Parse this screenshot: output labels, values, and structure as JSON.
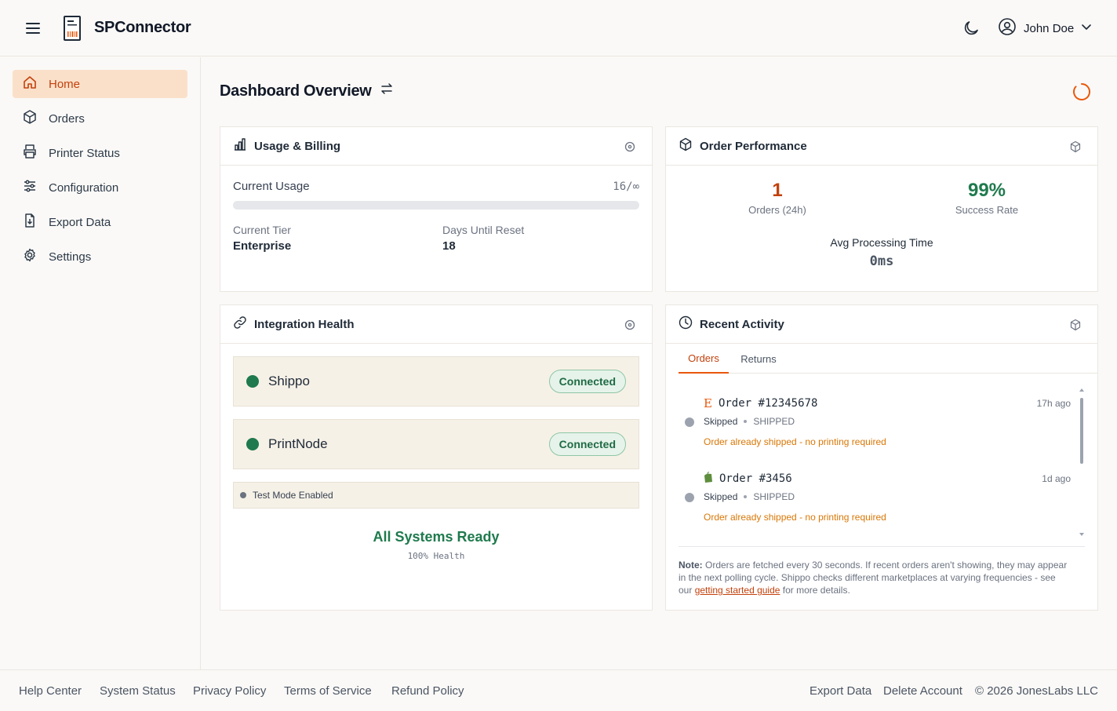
{
  "app": {
    "brand": "SPConnector"
  },
  "user": {
    "name": "John Doe"
  },
  "sidebar": {
    "items": [
      {
        "label": "Home",
        "icon": "home-icon",
        "active": true
      },
      {
        "label": "Orders",
        "icon": "box-icon"
      },
      {
        "label": "Printer Status",
        "icon": "printer-icon"
      },
      {
        "label": "Configuration",
        "icon": "sliders-icon"
      },
      {
        "label": "Export Data",
        "icon": "file-export-icon"
      },
      {
        "label": "Settings",
        "icon": "gear-icon"
      }
    ]
  },
  "page": {
    "title": "Dashboard Overview"
  },
  "usage": {
    "title": "Usage & Billing",
    "current_usage_label": "Current Usage",
    "current_usage_value": "16/∞",
    "progress_fraction": 0,
    "tier_label": "Current Tier",
    "tier_value": "Enterprise",
    "reset_label": "Days Until Reset",
    "reset_value": "18"
  },
  "performance": {
    "title": "Order Performance",
    "orders_value": "1",
    "orders_label": "Orders (24h)",
    "success_value": "99%",
    "success_label": "Success Rate",
    "avg_label": "Avg Processing Time",
    "avg_value": "0ms"
  },
  "integration": {
    "title": "Integration Health",
    "services": [
      {
        "name": "Shippo",
        "status": "Connected"
      },
      {
        "name": "PrintNode",
        "status": "Connected"
      }
    ],
    "test_mode": "Test Mode Enabled",
    "ready_text": "All Systems Ready",
    "health_text": "100% Health"
  },
  "activity": {
    "title": "Recent Activity",
    "tabs": [
      {
        "label": "Orders"
      },
      {
        "label": "Returns"
      }
    ],
    "items": [
      {
        "marketplace": "E",
        "title": "Order #12345678",
        "time": "17h ago",
        "status": "Skipped",
        "state": "SHIPPED",
        "message": "Order already shipped - no printing required"
      },
      {
        "marketplace": "shopify",
        "title": "Order #3456",
        "time": "1d ago",
        "status": "Skipped",
        "state": "SHIPPED",
        "message": "Order already shipped - no printing required"
      }
    ],
    "note_label": "Note:",
    "note_text_1": " Orders are fetched every 30 seconds. If recent orders aren't showing, they may appear in the next polling cycle. Shippo checks different marketplaces at varying frequencies - see our ",
    "note_link": "getting started guide",
    "note_text_2": " for more details."
  },
  "colors": {
    "accent": "#ea580c",
    "success": "#1f7a4d",
    "warning": "#d97706"
  },
  "footer": {
    "left_links": [
      "Help Center",
      "System Status",
      "Privacy Policy",
      "Terms of Service",
      "Refund Policy"
    ],
    "right_links": [
      "Export Data",
      "Delete Account"
    ],
    "copyright": "© 2026 JonesLabs LLC"
  }
}
